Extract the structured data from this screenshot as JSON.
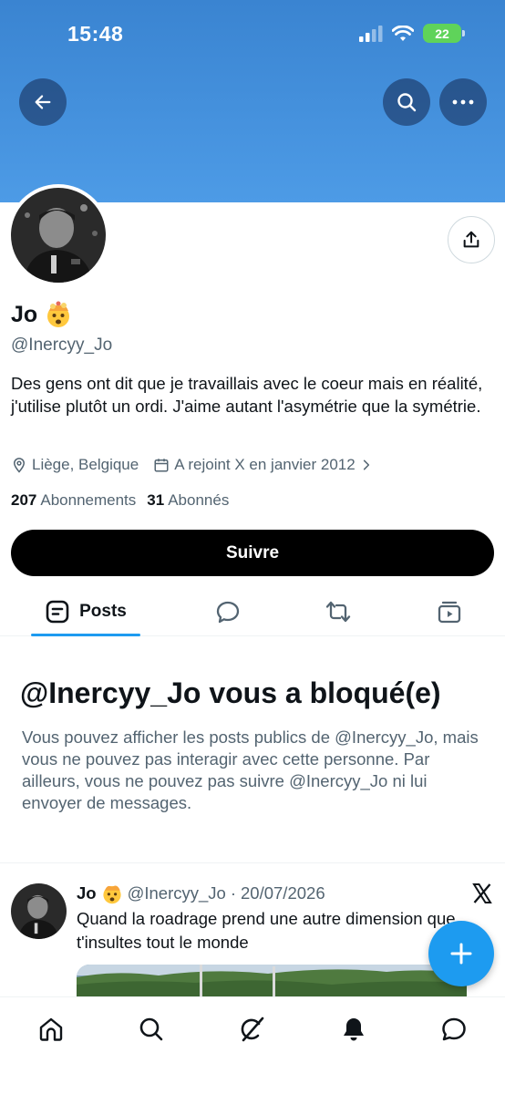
{
  "status_bar": {
    "time": "15:48",
    "battery": "22"
  },
  "header": {
    "back": "back-arrow-icon",
    "search": "search-icon",
    "more": "more-icon"
  },
  "profile": {
    "display_name": "Jo",
    "handle": "@Inercyy_Jo",
    "bio": "Des gens ont dit que je travaillais avec le coeur mais en réalité, j'utilise plutôt un ordi. J'aime autant l'asymétrie que la symétrie.",
    "location": "Liège, Belgique",
    "joined": "A rejoint X en janvier 2012",
    "following_count": "207",
    "following_label": "Abonnements",
    "followers_count": "31",
    "followers_label": "Abonnés",
    "follow_label": "Suivre"
  },
  "tabs": {
    "posts_label": "Posts"
  },
  "blocked": {
    "title": "@Inercyy_Jo vous a bloqué(e)",
    "text": "Vous pouvez afficher les posts publics de @Inercyy_Jo, mais vous ne pouvez pas interagir avec cette personne. Par ailleurs, vous ne pouvez pas suivre @Inercyy_Jo ni lui envoyer de messages."
  },
  "post": {
    "name": "Jo",
    "handle": "@Inercyy_Jo",
    "separator": "·",
    "date": "20/07/2026",
    "text": "Quand la roadrage prend une autre dimension que t'insultes tout le monde"
  },
  "colors": {
    "accent": "#1d9bf0",
    "banner": "#4d9be6",
    "text": "#0f1419",
    "muted": "#536471"
  }
}
